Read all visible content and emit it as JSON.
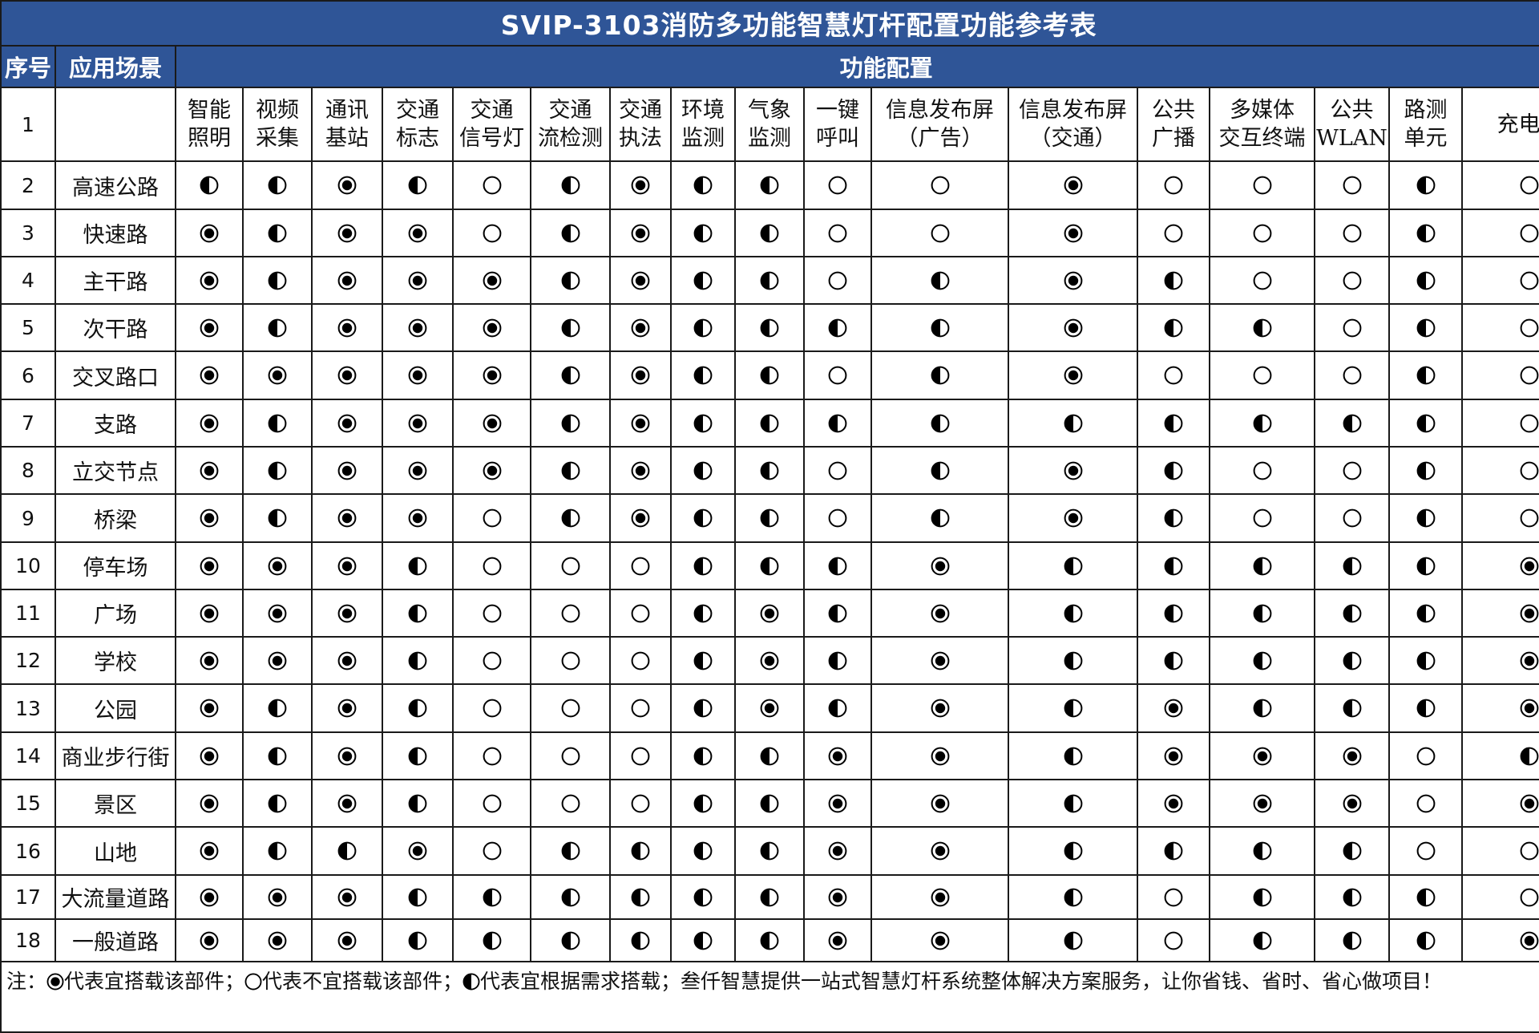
{
  "title": "SVIP-3103消防多功能智慧灯杆配置功能参考表",
  "header": {
    "index_label": "序号",
    "scene_label": "应用场景",
    "config_label": "功能配置",
    "first_row_index": "1"
  },
  "features": [
    [
      "智能",
      "照明"
    ],
    [
      "视频",
      "采集"
    ],
    [
      "通讯",
      "基站"
    ],
    [
      "交通",
      "标志"
    ],
    [
      "交通",
      "信号灯"
    ],
    [
      "交通",
      "流检测"
    ],
    [
      "交通",
      "执法"
    ],
    [
      "环境",
      "监测"
    ],
    [
      "气象",
      "监测"
    ],
    [
      "一键",
      "呼叫"
    ],
    [
      "信息发布屏",
      "（广告）"
    ],
    [
      "信息发布屏",
      "（交通）"
    ],
    [
      "公共",
      "广播"
    ],
    [
      "多媒体",
      "交互终端"
    ],
    [
      "公共",
      "WLAN"
    ],
    [
      "路测",
      "单元"
    ],
    [
      "充电桩"
    ]
  ],
  "symbols": {
    "recommended": "bullseye-icon",
    "not_recommended": "empty-circle-icon",
    "optional": "half-circle-icon"
  },
  "rows": [
    {
      "no": "2",
      "scene": "高速公路",
      "v": "HHFHEHFHHEEFEEEHE"
    },
    {
      "no": "3",
      "scene": "快速路",
      "v": "FHFFEHFHHEEFEEEHE"
    },
    {
      "no": "4",
      "scene": "主干路",
      "v": "FHFFFHFHHEHFHEEHE"
    },
    {
      "no": "5",
      "scene": "次干路",
      "v": "FHFFFHFHHHHFHHEHE"
    },
    {
      "no": "6",
      "scene": "交叉路口",
      "v": "FFFFFHFHHEHFEEEHE"
    },
    {
      "no": "7",
      "scene": "支路",
      "v": "FHFFFHFHHHHHHHHHE"
    },
    {
      "no": "8",
      "scene": "立交节点",
      "v": "FHFFFHFHHEHFHEEHE"
    },
    {
      "no": "9",
      "scene": "桥梁",
      "v": "FHFFEHFHHEHFHEEHE"
    },
    {
      "no": "10",
      "scene": "停车场",
      "v": "FFFHEEEHHHFHHHHHF"
    },
    {
      "no": "11",
      "scene": "广场",
      "v": "FFFHEEEHFHFHHHHHF"
    },
    {
      "no": "12",
      "scene": "学校",
      "v": "FFFHEEEHFHFHHHHHF"
    },
    {
      "no": "13",
      "scene": "公园",
      "v": "FHFHEEEHFHFHFHHHF"
    },
    {
      "no": "14",
      "scene": "商业步行街",
      "v": "FHFHEEEHHFFHFFFEH"
    },
    {
      "no": "15",
      "scene": "景区",
      "v": "FHFHEEEHHFFHFFFEF"
    },
    {
      "no": "16",
      "scene": "山地",
      "v": "FHHFEHHHHFFHHHHEE"
    },
    {
      "no": "17",
      "scene": "大流量道路",
      "v": "FFFHHHHHHFFHEHHHE"
    },
    {
      "no": "18",
      "scene": "一般道路",
      "v": "FFFHHHHHHFFHEHHHF"
    }
  ],
  "note": {
    "prefix": "注：",
    "recommended_text": "代表宜搭载该部件；",
    "not_recommended_text": "代表不宜搭载该部件；",
    "optional_text": "代表宜根据需求搭载；叁仟智慧提供一站式智慧灯杆系统整体解决方案服务，让你省钱、省时、省心做项目！"
  }
}
